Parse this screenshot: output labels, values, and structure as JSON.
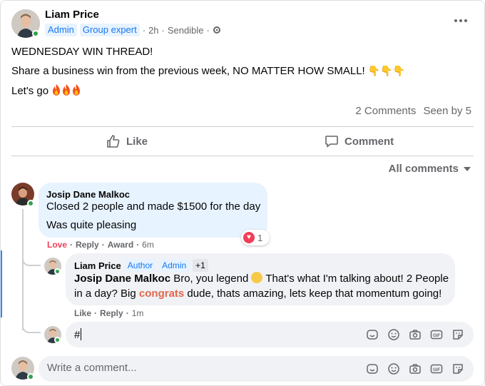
{
  "post": {
    "author": "Liam Price",
    "badges": [
      "Admin",
      "Group expert"
    ],
    "time": "2h",
    "separator": "·",
    "audience": "Sendible",
    "line1": "WEDNESDAY WIN THREAD!",
    "line2": "Share a business win from the previous week, NO MATTER HOW SMALL!",
    "line2_emoji": "👇👇👇",
    "line3": "Let's go"
  },
  "stats": {
    "comments": "2 Comments",
    "seen": "Seen by 5"
  },
  "actions": {
    "like": "Like",
    "comment": "Comment"
  },
  "filter": {
    "label": "All comments"
  },
  "comments": [
    {
      "author": "Josip Dane Malkoc",
      "line1": "Closed 2 people and made $1500 for the day",
      "line2": "Was quite pleasing",
      "reaction_count": "1",
      "actions": {
        "love": "Love",
        "reply": "Reply",
        "award": "Award",
        "time": "6m"
      }
    }
  ],
  "reply": {
    "author": "Liam Price",
    "badges": [
      "Author",
      "Admin",
      "+1"
    ],
    "mention": "Josip Dane Malkoc",
    "text_a": " Bro, you legend",
    "text_b": " That's what I'm talking about! 2 People",
    "text_c": "in a day? Big ",
    "highlight": "congrats",
    "text_d": " dude, thats amazing, lets keep that momentum going!",
    "actions": {
      "like": "Like",
      "reply": "Reply",
      "time": "1m"
    }
  },
  "reply_input": {
    "value": "#"
  },
  "comment_input": {
    "placeholder": "Write a comment..."
  },
  "colors": {
    "accent": "#1877f2",
    "love": "#f33e58",
    "online": "#31a24c",
    "congrats": "#e4674d"
  }
}
